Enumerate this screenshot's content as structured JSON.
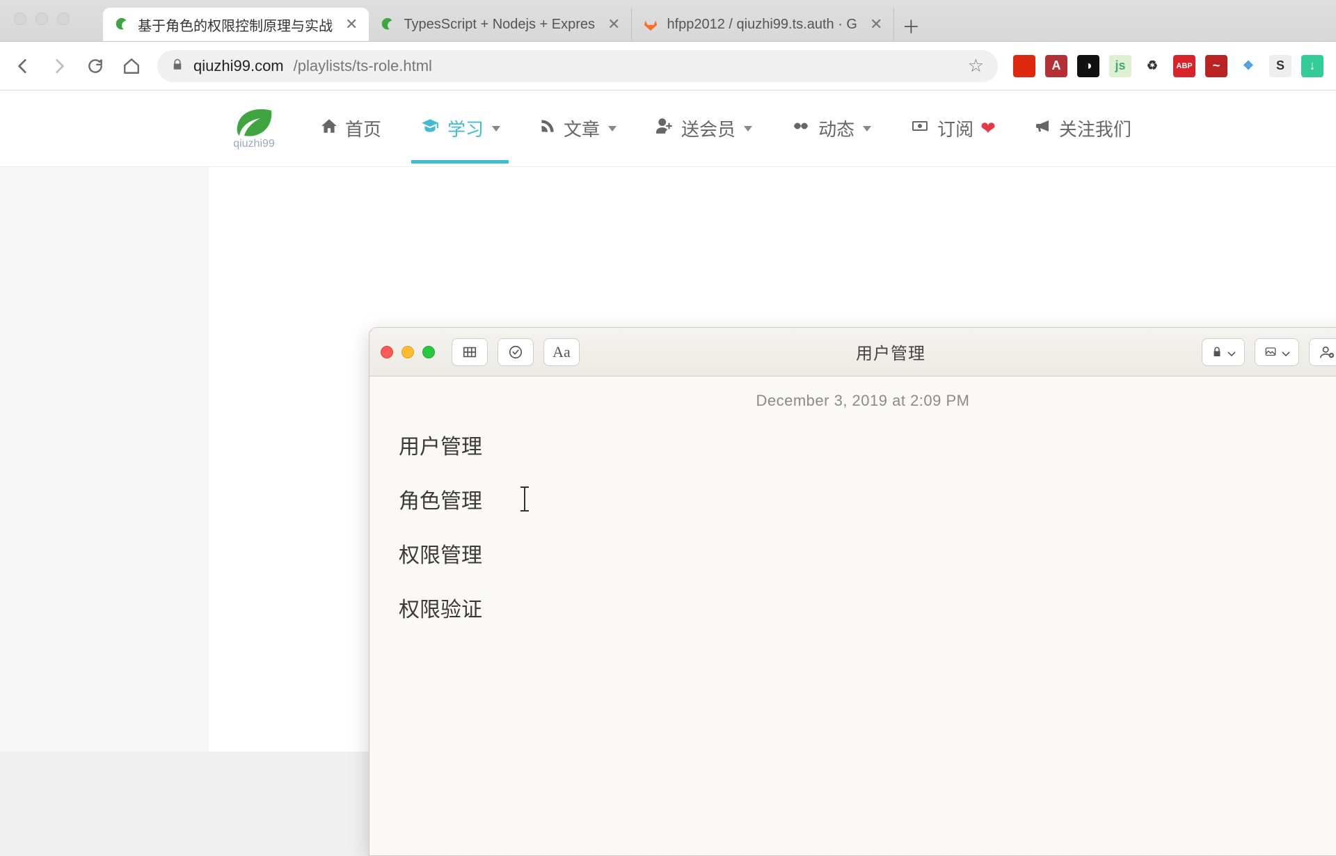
{
  "browser": {
    "tabs": [
      {
        "title": "基于角色的权限控制原理与实战",
        "favicon": "leaf"
      },
      {
        "title": "TypesScript + Nodejs + Expres",
        "favicon": "leaf"
      },
      {
        "title": "hfpp2012 / qiuzhi99.ts.auth · G",
        "favicon": "gitlab"
      }
    ],
    "url_domain": "qiuzhi99.com",
    "url_path": "/playlists/ts-role.html",
    "extensions": [
      {
        "name": "cn-flag",
        "bg": "#de2910",
        "glyph": ""
      },
      {
        "name": "a-ext",
        "bg": "#b53035",
        "glyph": "A"
      },
      {
        "name": "panda-ext",
        "bg": "#111",
        "glyph": "◑"
      },
      {
        "name": "js-ext",
        "bg": "#dff0d1",
        "glyph": "js",
        "fg": "#4a7"
      },
      {
        "name": "recycle-ext",
        "bg": "transparent",
        "glyph": "♻",
        "fg": "#333"
      },
      {
        "name": "abp-ext",
        "bg": "#d8232a",
        "glyph": "ABP",
        "fs": "11"
      },
      {
        "name": "wave-ext",
        "bg": "#b22",
        "glyph": "~"
      },
      {
        "name": "v-ext",
        "bg": "transparent",
        "glyph": "❖",
        "fg": "#4aa3df"
      },
      {
        "name": "s-ext",
        "bg": "#eee",
        "glyph": "S",
        "fg": "#333"
      },
      {
        "name": "dl-ext",
        "bg": "#3c9",
        "glyph": "↓"
      }
    ]
  },
  "site": {
    "brand": "qiuzhi99",
    "nav": [
      {
        "label": "首页",
        "icon": "home"
      },
      {
        "label": "学习",
        "icon": "grad",
        "dropdown": true,
        "active": true
      },
      {
        "label": "文章",
        "icon": "rss",
        "dropdown": true
      },
      {
        "label": "送会员",
        "icon": "user-plus",
        "dropdown": true
      },
      {
        "label": "动态",
        "icon": "hands",
        "dropdown": true
      },
      {
        "label": "订阅",
        "icon": "cash",
        "heart": true
      },
      {
        "label": "关注我们",
        "icon": "horn"
      }
    ]
  },
  "notes": {
    "title": "用户管理",
    "date": "December 3, 2019 at 2:09 PM",
    "lines": [
      "用户管理",
      "角色管理",
      "权限管理",
      "权限验证"
    ],
    "cursor_after_line_index": 1
  }
}
